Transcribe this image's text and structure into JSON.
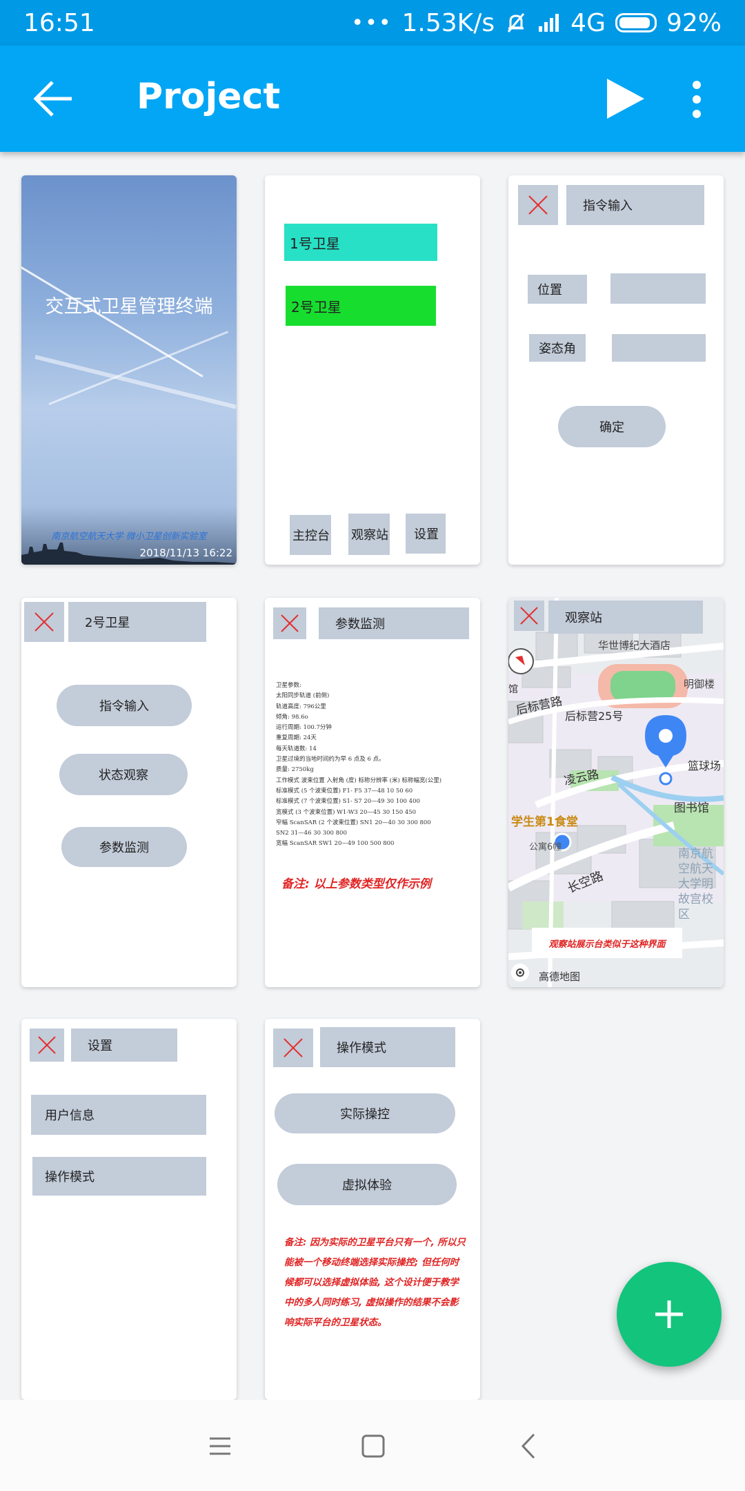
{
  "status_bar": {
    "time": "16:51",
    "dots": "•••",
    "speed": "1.53K/s",
    "network": "4G",
    "battery": "92%",
    "battery_level": 0.92
  },
  "app_bar": {
    "title": "Project"
  },
  "cards": {
    "splash": {
      "title": "交互式卫星管理终端",
      "subtitle": "南京航空航天大学 微小卫星创新实验室",
      "date": "2018/11/13 16:22"
    },
    "satellites": {
      "sat1": "1号卫星",
      "sat2": "2号卫星",
      "tab_main": "主控台",
      "tab_station": "观察站",
      "tab_settings": "设置"
    },
    "command": {
      "header": "指令输入",
      "position": "位置",
      "attitude": "姿态角",
      "confirm": "确定"
    },
    "sat2_menu": {
      "header": "2号卫星",
      "command": "指令输入",
      "status": "状态观察",
      "params": "参数监测"
    },
    "param_monitor": {
      "header": "参数监测",
      "lines": [
        "卫星参数:",
        "太阳同步轨道 (前倒)",
        "轨道高度: 796公里",
        "倾角: 98.6o",
        "运行周期: 100.7分钟",
        "重复周期: 24天",
        "每天轨道数: 14",
        "卫星过境的当地时间约为早 6 点及 6 点。",
        "质量: 2750kg",
        "工作模式 波束位置 入射角 (度) 标称分辨率 (米) 标称幅宽(公里)",
        "标准模式 (5 个波束位置) F1- F5 37—48 10 50 60",
        "标准模式 (7 个波束位置) S1- S7 20—49 30 100 400",
        "宽模式 (3 个波束位置) W1-W3 20—45 30 150 450",
        "窄幅 ScanSAR (2 个波束位置) SN1 20—40 30 300 800",
        "SN2 31—46 30 300 800",
        "宽幅 ScanSAR SW1 20—49 100 500 800"
      ],
      "note": "备注: 以上参数类型仅作示例"
    },
    "station": {
      "header": "观察站",
      "note": "观察站展示台类似于这种界面",
      "map_labels": {
        "hotel": "华世博纪大酒店",
        "mingyu": "明御楼",
        "houbiao": "后标营路",
        "houbiao25": "后标营25号",
        "lingyun": "凌云路",
        "ballfield": "篮球场",
        "library": "图书馆",
        "canteen": "学生第1食堂",
        "changkong": "长空路",
        "gongyu": "公寓6幢",
        "nanhang": "南京航空航天大学明故宫校区",
        "guan": "馆",
        "amap": "高德地图"
      }
    },
    "settings": {
      "header": "设置",
      "user_info": "用户信息",
      "op_mode": "操作模式"
    },
    "op_mode": {
      "header": "操作模式",
      "actual": "实际操控",
      "virtual": "虚拟体验",
      "note": "备注: 因为实际的卫星平台只有一个, 所以只能被一个移动终端选择实际操控; 但任何时候都可以选择虚拟体验, 这个设计便于教学中的多人同时练习, 虚拟操作的结果不会影响实际平台的卫星状态。"
    }
  },
  "colors": {
    "app_bar": "#03a6f5",
    "status_bar": "#0099e6",
    "fab": "#12c47c",
    "sat1": "#28e0c6",
    "sat2": "#17de2e",
    "widget_gray": "#c3ccd9",
    "note_red": "#e02424"
  }
}
